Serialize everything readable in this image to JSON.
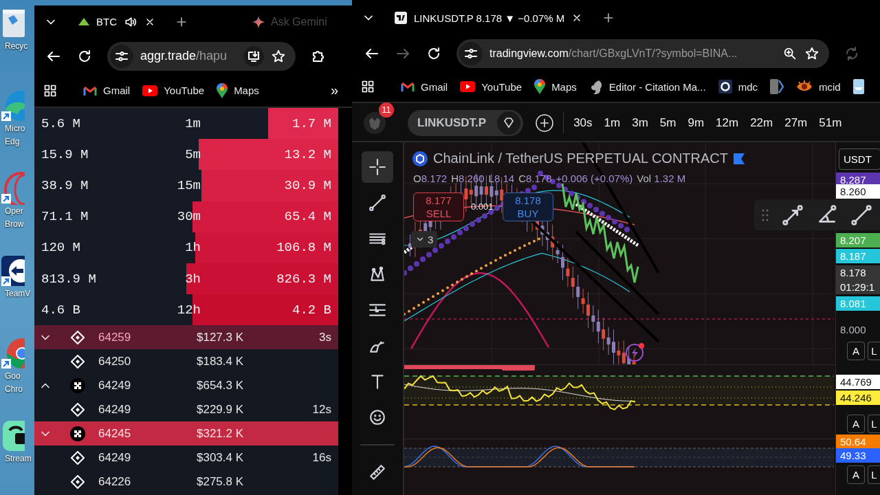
{
  "desktop": {
    "icons": [
      {
        "kind": "recycle",
        "lines": [
          "Recyc"
        ]
      },
      {
        "kind": "edge",
        "lines": [
          "Micro",
          "Edg"
        ]
      },
      {
        "kind": "opera",
        "lines": [
          "Oper",
          "Brow"
        ]
      },
      {
        "kind": "teamviewer",
        "lines": [
          "TeamV"
        ]
      },
      {
        "kind": "chrome",
        "lines": [
          "Goo",
          "Chro"
        ]
      },
      {
        "kind": "stream",
        "lines": [
          "Stream"
        ]
      }
    ]
  },
  "left_window": {
    "tabs": [
      {
        "title": "BTC",
        "selected": true,
        "audio": true
      }
    ],
    "ask_gemini": "Ask Gemini",
    "url": {
      "domain": "aggr.trade",
      "path": "/hapu"
    },
    "bookmarks": [
      {
        "kind": "gmail",
        "label": "Gmail"
      },
      {
        "kind": "youtube",
        "label": "YouTube"
      },
      {
        "kind": "maps",
        "label": "Maps"
      }
    ],
    "more": "»"
  },
  "stats": [
    {
      "buy": "5.6 M",
      "period": "1m",
      "sell": "1.7 M",
      "level": 0.23
    },
    {
      "buy": "15.9 M",
      "period": "5m",
      "sell": "13.2 M",
      "level": 0.46
    },
    {
      "buy": "38.9 M",
      "period": "15m",
      "sell": "30.9 M",
      "level": 0.45
    },
    {
      "buy": "71.1 M",
      "period": "30m",
      "sell": "65.4 M",
      "level": 0.48
    },
    {
      "buy": "120 M",
      "period": "1h",
      "sell": "106.8 M",
      "level": 0.47
    },
    {
      "buy": "813.9 M",
      "period": "3h",
      "sell": "826.3 M",
      "level": 0.5
    },
    {
      "buy": "4.6 B",
      "period": "12h",
      "sell": "4.2 B",
      "level": 0.48
    }
  ],
  "trades": [
    {
      "arrow_down": true,
      "arrow_up": false,
      "kind": "diamond",
      "price": "64259",
      "amount": "$127.3 K",
      "age": "3s",
      "color": "#5e1b30"
    },
    {
      "arrow_down": false,
      "arrow_up": false,
      "kind": "diamond",
      "price": "64250",
      "amount": "$183.4 K",
      "color": "#141821"
    },
    {
      "arrow_down": false,
      "arrow_up": true,
      "kind": "cross",
      "price": "64249",
      "amount": "$654.3 K",
      "color": "#141821"
    },
    {
      "arrow_down": false,
      "arrow_up": false,
      "kind": "diamond",
      "price": "64249",
      "amount": "$229.9 K",
      "age": "12s",
      "color": "#141821"
    },
    {
      "arrow_down": true,
      "arrow_up": false,
      "kind": "cross",
      "price": "64245",
      "amount": "$321.2 K",
      "color": "#c42942"
    },
    {
      "arrow_down": false,
      "arrow_up": false,
      "kind": "diamond",
      "price": "64249",
      "amount": "$303.4 K",
      "age": "16s",
      "color": "#141821"
    },
    {
      "arrow_down": false,
      "arrow_up": false,
      "kind": "diamond",
      "price": "64226",
      "amount": "$275.8 K",
      "color": "#141821"
    }
  ],
  "right_window": {
    "tabs": [
      {
        "title": "LINKUSDT.P 8.178 ▼ −0.07% M",
        "selected": true
      }
    ],
    "forward_disabled": true,
    "url": {
      "domain": "tradingview.com",
      "path": "/chart/GBxgLVnT/?symbol=BINA..."
    },
    "bookmarks": [
      {
        "kind": "gmail",
        "label": "Gmail"
      },
      {
        "kind": "youtube",
        "label": "YouTube"
      },
      {
        "kind": "maps",
        "label": "Maps"
      },
      {
        "kind": "squirrel",
        "label": "Editor - Citation Ma..."
      },
      {
        "kind": "ring",
        "label": "mdc"
      },
      {
        "kind": "chevron"
      },
      {
        "kind": "eye",
        "label": "mcid"
      },
      {
        "kind": "boat"
      }
    ]
  },
  "tradingview": {
    "notifications": "11",
    "symbol": "LINKUSDT.P",
    "timeframes": [
      "30s",
      "1m",
      "3m",
      "5m",
      "9m",
      "12m",
      "22m",
      "27m",
      "51m"
    ],
    "tools": [
      {
        "kind": "crosshair",
        "selected": true
      },
      {
        "kind": "trendline",
        "selected": false
      },
      {
        "kind": "hlines",
        "selected": false
      },
      {
        "kind": "pattern",
        "selected": false
      },
      {
        "kind": "fib",
        "selected": false
      },
      {
        "kind": "brush",
        "selected": false
      },
      {
        "kind": "text",
        "selected": false
      },
      {
        "kind": "emoji",
        "selected": false
      },
      {
        "kind": "ruler",
        "selected": false
      }
    ],
    "title": "ChainLink / TetherUS PERPETUAL CONTRACT",
    "legend": [
      {
        "label": "O",
        "value": "8.172"
      },
      {
        "label": "H",
        "value": "8.260"
      },
      {
        "label": "L",
        "value": "8.14"
      },
      {
        "label": "C",
        "value": "8.178"
      }
    ],
    "change": "+0.006 (+0.07%)",
    "vol_label": "Vol",
    "volume": "1.32 M",
    "sell": {
      "price": "8.177",
      "label": "SELL"
    },
    "spread": "0.001",
    "buy": {
      "price": "8.178",
      "label": "BUY"
    },
    "indicators_count": "3",
    "currency": "USDT",
    "panes": [
      {
        "labels": [
          {
            "text": "8.287",
            "color": "#5e35b1"
          },
          {
            "text": "8.260",
            "color": "#ffffff"
          },
          {
            "text": "8.207",
            "color": "#4caf50"
          },
          {
            "text": "8.187",
            "color": "#26c6da"
          },
          {
            "text": "8.178",
            "sub": "01:29:1",
            "color": "#363636"
          },
          {
            "text": "8.081",
            "color": "#26c6da"
          },
          {
            "text": "8.000"
          }
        ],
        "buttons": [
          "A",
          "L"
        ]
      },
      {
        "labels": [
          {
            "text": "44.769",
            "color": "#ffffff"
          },
          {
            "text": "44.246",
            "color": "#ffeb3b"
          }
        ],
        "buttons": [
          "A",
          "L"
        ]
      },
      {
        "labels": [
          {
            "text": "50.64",
            "color": "#f57c00"
          },
          {
            "text": "49.33",
            "color": "#2962ff"
          }
        ],
        "buttons": [
          "A",
          "L"
        ]
      }
    ]
  }
}
